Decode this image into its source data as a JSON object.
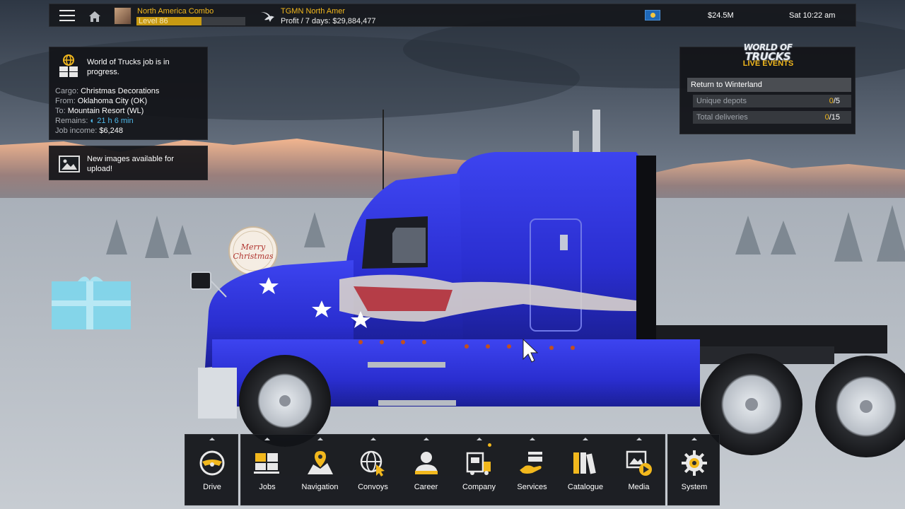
{
  "topbar": {
    "company_name": "North America Combo",
    "level_label": "Level 86",
    "level_progress": 0.6,
    "hq_name": "TGMN North Amer",
    "profit_text": "Profit / 7 days: $29,884,477",
    "money": "$24.5M",
    "game_time": "Sat 10:22 am"
  },
  "job_notice": {
    "title": "World of Trucks job is in progress.",
    "cargo_label": "Cargo:",
    "cargo_value": "Christmas Decorations",
    "from_label": "From:",
    "from_value": "Oklahoma City (OK)",
    "to_label": "To:",
    "to_value": "Mountain Resort (WL)",
    "remains_label": "Remains:",
    "remains_value": "21 h 6 min",
    "income_label": "Job income:",
    "income_value": "$6,248"
  },
  "image_notice": {
    "title": "New images available for upload!"
  },
  "live_events": {
    "logo_line1": "WORLD OF",
    "logo_line2": "TRUCKS",
    "title": "LIVE EVENTS",
    "event_name": "Return to Winterland",
    "rows": [
      {
        "label": "Unique depots",
        "current": "0",
        "total": "/5"
      },
      {
        "label": "Total deliveries",
        "current": "0",
        "total": "/15"
      }
    ]
  },
  "scene": {
    "badge_line1": "Merry",
    "badge_line2": "Christmas",
    "truck_color": "#2b2fd6",
    "accent_color": "#f2b81d"
  },
  "dock": {
    "drive": "Drive",
    "jobs": "Jobs",
    "navigation": "Navigation",
    "convoys": "Convoys",
    "career": "Career",
    "company": "Company",
    "services": "Services",
    "catalogue": "Catalogue",
    "media": "Media",
    "system": "System"
  }
}
